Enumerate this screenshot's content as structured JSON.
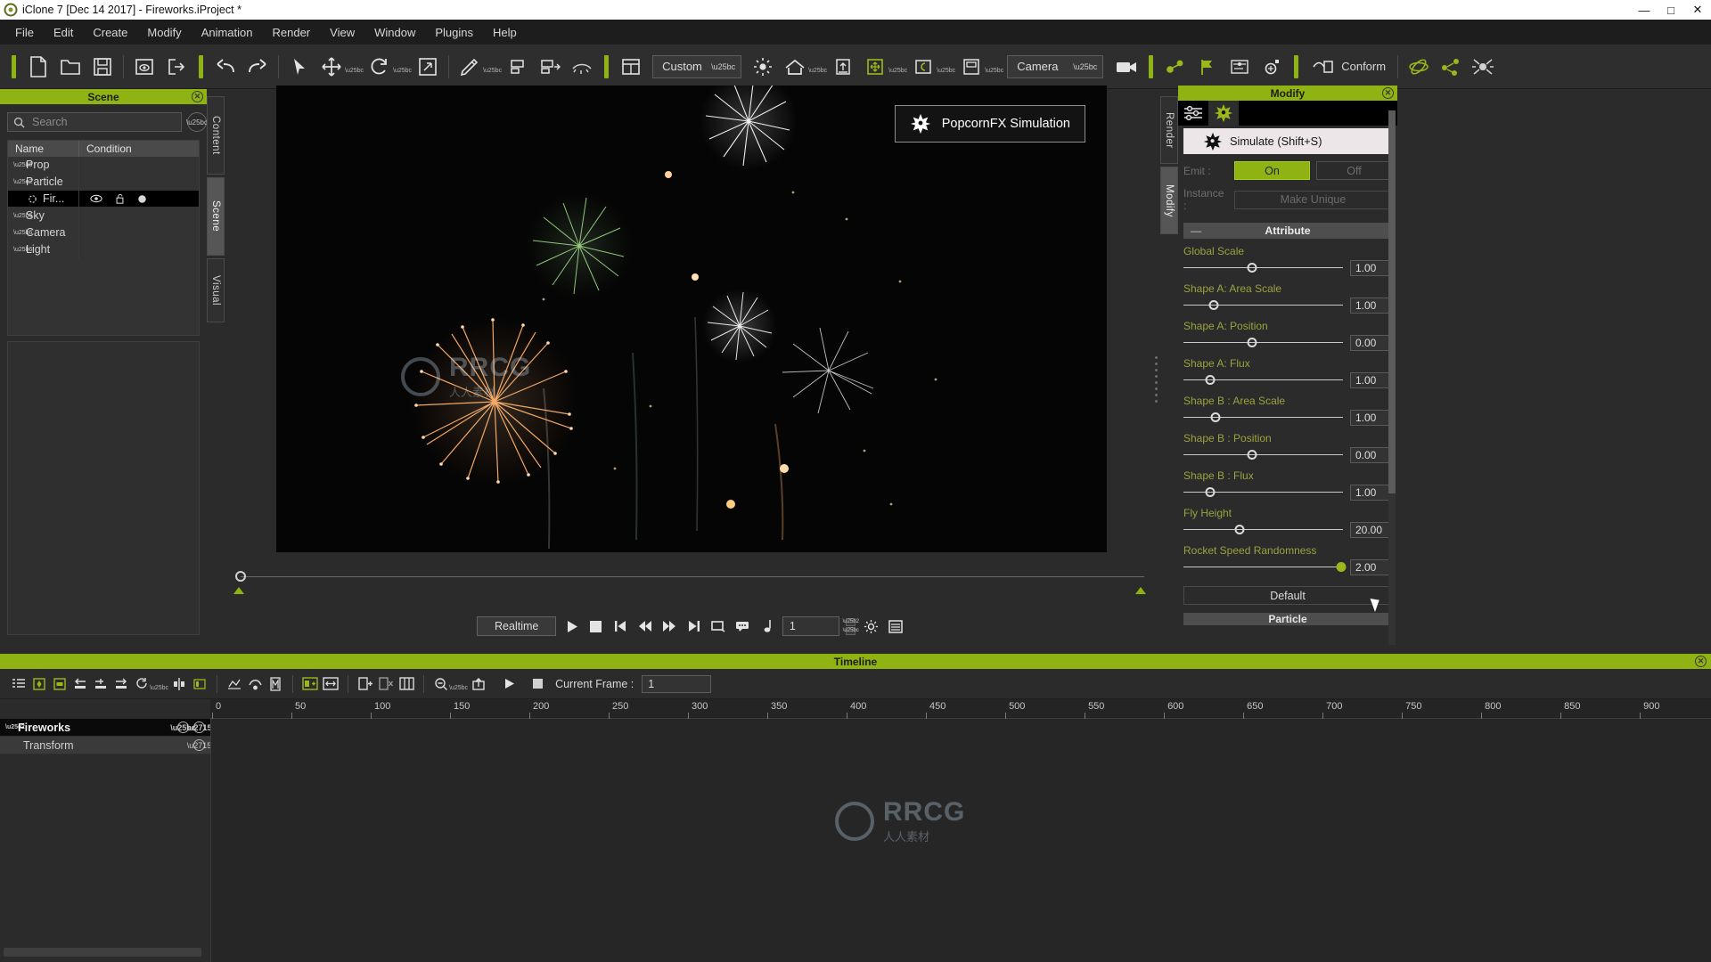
{
  "window": {
    "title": "iClone 7 [Dec 14 2017] - Fireworks.iProject *",
    "minimize": "—",
    "maximize": "□",
    "close": "✕"
  },
  "menubar": [
    "File",
    "Edit",
    "Create",
    "Modify",
    "Animation",
    "Render",
    "View",
    "Window",
    "Plugins",
    "Help"
  ],
  "toolbar": {
    "project_combo": "Custom",
    "camera_combo": "Camera",
    "conform_label": "Conform",
    "icons": [
      "new-project-icon",
      "open-project-icon",
      "save-project-icon",
      "preview-icon",
      "export-icon",
      "undo-icon",
      "redo-icon",
      "select-tool-icon",
      "move-tool-icon",
      "rotate-tool-icon",
      "scale-tool-icon",
      "edit-motion-icon",
      "align-left-icon",
      "align-right-icon",
      "eyelash-icon",
      "layout-icon",
      "light-icon",
      "home-icon",
      "ground-icon",
      "move-grid-icon",
      "pivot-icon",
      "screen-icon",
      "video-camera-icon",
      "link-icon",
      "flag-icon",
      "path-icon",
      "orbit-icon",
      "conform-icon",
      "physics-icon",
      "share-icon",
      "spider-icon"
    ]
  },
  "scene_panel": {
    "title": "Scene",
    "close": "✕",
    "search_placeholder": "Search",
    "columns": [
      "Name",
      "Condition"
    ],
    "rows": [
      {
        "name": "Prop",
        "expanded": false,
        "selected": false,
        "indent": 0
      },
      {
        "name": "Particle",
        "expanded": true,
        "selected": false,
        "indent": 0
      },
      {
        "name": "Fir...",
        "expanded": null,
        "selected": true,
        "indent": 1
      },
      {
        "name": "Sky",
        "expanded": false,
        "selected": false,
        "indent": 0
      },
      {
        "name": "Camera",
        "expanded": false,
        "selected": false,
        "indent": 0
      },
      {
        "name": "Light",
        "expanded": false,
        "selected": false,
        "indent": 0
      }
    ]
  },
  "vertical_tabs": [
    {
      "label": "Content",
      "active": false
    },
    {
      "label": "Scene",
      "active": true
    },
    {
      "label": "Visual",
      "active": false
    }
  ],
  "viewport": {
    "badge_label": "PopcornFX Simulation",
    "watermark_title": "RRCG",
    "watermark_sub": "人人素材"
  },
  "transport": {
    "mode_label": "Realtime",
    "frame_value": "1",
    "buttons": [
      "play-icon",
      "stop-icon",
      "go-to-start-icon",
      "rewind-icon",
      "fast-forward-icon",
      "go-to-end-icon",
      "loop-icon",
      "speech-icon",
      "audio-note-icon",
      "preferences-icon",
      "list-icon"
    ]
  },
  "modify_panel": {
    "title": "Modify",
    "close": "✕",
    "tab_icons": [
      "sliders-icon",
      "popcornfx-icon"
    ],
    "simulate_label": "Simulate (Shift+S)",
    "emit_label": "Emit :",
    "emit_on": "On",
    "emit_off": "Off",
    "instance_label": "Instance :",
    "make_unique": "Make Unique",
    "attribute_header": "Attribute",
    "collapse_glyph": "—",
    "default_button": "Default",
    "particle_header": "Particle",
    "attributes": [
      {
        "label": "Global Scale",
        "value": "1.00",
        "pct": 43,
        "active": false
      },
      {
        "label": "Shape A: Area Scale",
        "value": "1.00",
        "pct": 19,
        "active": false
      },
      {
        "label": "Shape A: Position",
        "value": "0.00",
        "pct": 43,
        "active": false
      },
      {
        "label": "Shape A: Flux",
        "value": "1.00",
        "pct": 17,
        "active": false
      },
      {
        "label": "Shape B : Area Scale",
        "value": "1.00",
        "pct": 20,
        "active": false
      },
      {
        "label": "Shape B : Position",
        "value": "0.00",
        "pct": 43,
        "active": false
      },
      {
        "label": "Shape B : Flux",
        "value": "1.00",
        "pct": 17,
        "active": false
      },
      {
        "label": "Fly Height",
        "value": "20.00",
        "pct": 35,
        "active": false
      },
      {
        "label": "Rocket Speed Randomness",
        "value": "2.00",
        "pct": 99,
        "active": true
      }
    ]
  },
  "right_tabs": [
    {
      "label": "Render",
      "active": false
    },
    {
      "label": "Modify",
      "active": true
    }
  ],
  "timeline": {
    "title": "Timeline",
    "close": "✕",
    "current_frame_label": "Current Frame :",
    "current_frame_value": "1",
    "play_icon": "play-icon",
    "stop_icon": "stop-icon",
    "tool_icons": [
      "track-list-icon",
      "key-icon",
      "clip-icon",
      "collapse-left-icon",
      "add-key-icon",
      "shift-right-icon",
      "loop-icon",
      "center-icon",
      "range-icon",
      "curve-icon",
      "reverse-icon",
      "motion-icon",
      "add-clip-icon",
      "resize-clip-icon",
      "insert-icon",
      "delete-icon",
      "split-icon",
      "zoom-out-icon",
      "export-clip-icon"
    ],
    "ruler_ticks": [
      "0",
      "50",
      "100",
      "150",
      "200",
      "250",
      "300",
      "350",
      "400",
      "450",
      "500",
      "550",
      "600",
      "650",
      "700",
      "750",
      "800",
      "850",
      "900"
    ],
    "tracks": [
      {
        "name": "Fireworks",
        "type": "root"
      },
      {
        "name": "Transform",
        "type": "child"
      }
    ]
  }
}
